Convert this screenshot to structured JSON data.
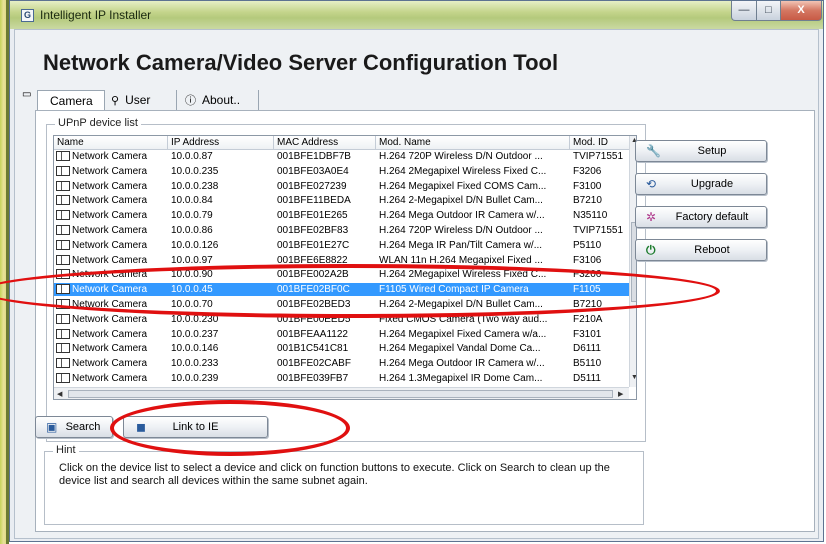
{
  "window": {
    "title": "Intelligent IP Installer",
    "icon": "app-icon",
    "icon_glyph": "G"
  },
  "window_controls": {
    "minimize": "—",
    "maximize": "□",
    "close": "X"
  },
  "heading": "Network Camera/Video Server Configuration Tool",
  "tabs": [
    {
      "label": "Camera",
      "icon": "camera-icon"
    },
    {
      "label": "User",
      "icon": "user-icon"
    },
    {
      "label": "About..",
      "icon": "info-icon"
    }
  ],
  "upnp": {
    "title": "UPnP device list",
    "columns": [
      "Name",
      "IP Address",
      "MAC Address",
      "Mod. Name",
      "Mod. ID"
    ],
    "rows": [
      [
        "Network Camera",
        "10.0.0.87",
        "001BFE1DBF7B",
        "H.264 720P Wireless D/N Outdoor ...",
        "TVIP71551"
      ],
      [
        "Network Camera",
        "10.0.0.235",
        "001BFE03A0E4",
        "H.264 2Megapixel Wireless Fixed C...",
        "F3206"
      ],
      [
        "Network Camera",
        "10.0.0.238",
        "001BFE027239",
        "H.264 Megapixel Fixed COMS Cam...",
        "F3100"
      ],
      [
        "Network Camera",
        "10.0.0.84",
        "001BFE11BEDA",
        "H.264 2-Megapixel D/N Bullet Cam...",
        "B7210"
      ],
      [
        "Network Camera",
        "10.0.0.79",
        "001BFE01E265",
        "H.264 Mega Outdoor IR Camera w/...",
        "N35110"
      ],
      [
        "Network Camera",
        "10.0.0.86",
        "001BFE02BF83",
        "H.264 720P Wireless D/N Outdoor ...",
        "TVIP71551"
      ],
      [
        "Network Camera",
        "10.0.0.126",
        "001BFE01E27C",
        "H.264 Mega IR Pan/Tilt Camera w/...",
        "P5110"
      ],
      [
        "Network Camera",
        "10.0.0.97",
        "001BFE6E8822",
        "WLAN 11n H.264 Megapixel Fixed ...",
        "F3106"
      ],
      [
        "Network Camera",
        "10.0.0.90",
        "001BFE002A2B",
        "H.264 2Megapixel Wireless Fixed C...",
        "F3206"
      ],
      [
        "Network Camera",
        "10.0.0.45",
        "001BFE02BF0C",
        "F1105 Wired Compact IP Camera",
        "F1105"
      ],
      [
        "Network Camera",
        "10.0.0.70",
        "001BFE02BED3",
        "H.264 2-Megapixel D/N Bullet Cam...",
        "B7210"
      ],
      [
        "Network Camera",
        "10.0.0.230",
        "001BFE00EED5",
        "Fixed CMOS Camera (Two way aud...",
        "F210A"
      ],
      [
        "Network Camera",
        "10.0.0.237",
        "001BFEAA1122",
        "H.264 Megapixel Fixed Camera w/a...",
        "F3101"
      ],
      [
        "Network Camera",
        "10.0.0.146",
        "001B1C541C81",
        "H.264 Megapixel Vandal Dome Ca...",
        "D6111"
      ],
      [
        "Network Camera",
        "10.0.0.233",
        "001BFE02CABF",
        "H.264 Mega Outdoor IR Camera w/...",
        "B5110"
      ],
      [
        "Network Camera",
        "10.0.0.239",
        "001BFE039FB7",
        "H.264 1.3Megapixel IR Dome Cam...",
        "D5111"
      ]
    ],
    "selected_row_index": 9
  },
  "buttons": {
    "search": {
      "label": "Search",
      "icon": "search-icon"
    },
    "link_to_ie": {
      "label": "Link to IE",
      "icon": "ie-icon"
    },
    "setup": {
      "label": "Setup",
      "icon": "wrench-icon"
    },
    "upgrade": {
      "label": "Upgrade",
      "icon": "upgrade-icon"
    },
    "factory_default": {
      "label": "Factory default",
      "icon": "reset-icon"
    },
    "reboot": {
      "label": "Reboot",
      "icon": "power-icon"
    }
  },
  "hint": {
    "title": "Hint",
    "text": "Click on the device list to select a device and click on function buttons to execute. Click on Search to clean up the device list and search all devices  within the same subnet again."
  },
  "annotation_color": "#e01010",
  "selection_color": "#3399ff"
}
